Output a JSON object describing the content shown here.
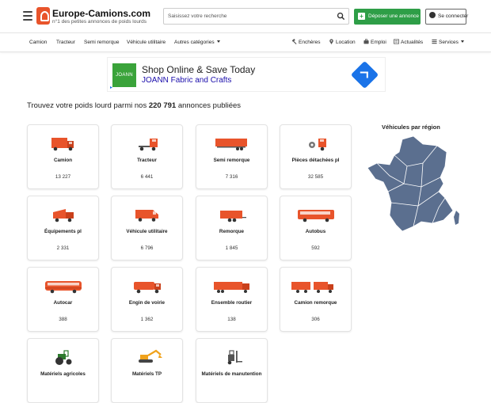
{
  "header": {
    "site_name": "Europe-Camions.com",
    "tagline": "n°1 des petites annonces de poids lourds",
    "search_placeholder": "Saisissez votre recherche",
    "post_ad_label": "Déposer une annonce",
    "login_label": "Se connecter"
  },
  "nav": {
    "left": [
      "Camion",
      "Tracteur",
      "Semi remorque",
      "Véhicule utilitaire",
      "Autres catégories"
    ],
    "right": [
      "Enchères",
      "Location",
      "Emploi",
      "Actualités",
      "Services"
    ]
  },
  "ad": {
    "logo_text": "JOANN",
    "title": "Shop Online & Save Today",
    "subtitle": "JOANN Fabric and Crafts",
    "colors": {
      "logo": "#3aa33a",
      "cta": "#1a73e8"
    }
  },
  "headline": {
    "prefix": "Trouvez votre poids lourd parmi nos",
    "count": "220 791",
    "suffix": "annonces publiées"
  },
  "categories": [
    {
      "label": "Camion",
      "count": "13 227",
      "icon": "truck-icon"
    },
    {
      "label": "Tracteur",
      "count": "6 441",
      "icon": "tractor-unit-icon"
    },
    {
      "label": "Semi remorque",
      "count": "7 316",
      "icon": "semi-trailer-icon"
    },
    {
      "label": "Pièces détachées pl",
      "count": "32 585",
      "icon": "spare-parts-icon"
    },
    {
      "label": "Équipements pl",
      "count": "2 331",
      "icon": "equipment-icon"
    },
    {
      "label": "Véhicule utilitaire",
      "count": "6 796",
      "icon": "van-icon"
    },
    {
      "label": "Remorque",
      "count": "1 845",
      "icon": "trailer-icon"
    },
    {
      "label": "Autobus",
      "count": "592",
      "icon": "bus-icon"
    },
    {
      "label": "Autocar",
      "count": "388",
      "icon": "coach-icon"
    },
    {
      "label": "Engin de voirie",
      "count": "1 362",
      "icon": "road-vehicle-icon"
    },
    {
      "label": "Ensemble routier",
      "count": "138",
      "icon": "road-train-icon"
    },
    {
      "label": "Camion remorque",
      "count": "306",
      "icon": "truck-trailer-icon"
    },
    {
      "label": "Matériels agricoles",
      "count": "",
      "icon": "farm-tractor-icon"
    },
    {
      "label": "Matériels TP",
      "count": "",
      "icon": "excavator-icon"
    },
    {
      "label": "Matériels de manutention",
      "count": "",
      "icon": "forklift-icon"
    }
  ],
  "regions": {
    "title": "Véhicules par région",
    "map_color": "#5b6f8f"
  },
  "colors": {
    "brand": "#e8542b",
    "post_button": "#2e9e47",
    "icon_orange": "#e8542b"
  }
}
